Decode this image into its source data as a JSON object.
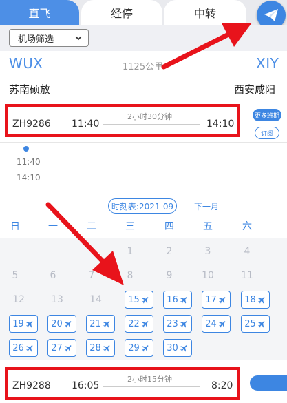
{
  "tabs": [
    {
      "label": "直飞"
    },
    {
      "label": "经停"
    },
    {
      "label": "中转"
    }
  ],
  "filter": {
    "label": "机场筛选"
  },
  "route": {
    "from_code": "WUX",
    "to_code": "XIY",
    "distance": "1125公里",
    "from_airport": "苏南硕放",
    "to_airport": "西安咸阳"
  },
  "flights": [
    {
      "no": "ZH9286",
      "dep": "11:40",
      "duration": "2小时30分钟",
      "arr": "14:10"
    },
    {
      "no": "ZH9288",
      "dep": "16:05",
      "duration": "2小时15分钟",
      "arr": "8:20"
    }
  ],
  "actions": {
    "more_label": "更多班期",
    "book_label": "订阅"
  },
  "timeline": {
    "t1": "11:40",
    "t2": "14:10"
  },
  "calendar": {
    "month_label": "时刻表:2021-09",
    "next_label": "下一月",
    "weekdays": [
      "日",
      "一",
      "二",
      "三",
      "四",
      "五",
      "六"
    ],
    "inactive_days": [
      "1",
      "2",
      "3",
      "4",
      "5",
      "6",
      "7",
      "8",
      "9",
      "10",
      "11",
      "12",
      "13",
      "14"
    ],
    "flight_days": [
      "15",
      "16",
      "17",
      "18",
      "19",
      "20",
      "21",
      "22",
      "23",
      "24",
      "25",
      "26",
      "27",
      "28",
      "29",
      "30"
    ]
  },
  "colors": {
    "accent": "#3d86e2",
    "highlight": "#e8131b"
  }
}
